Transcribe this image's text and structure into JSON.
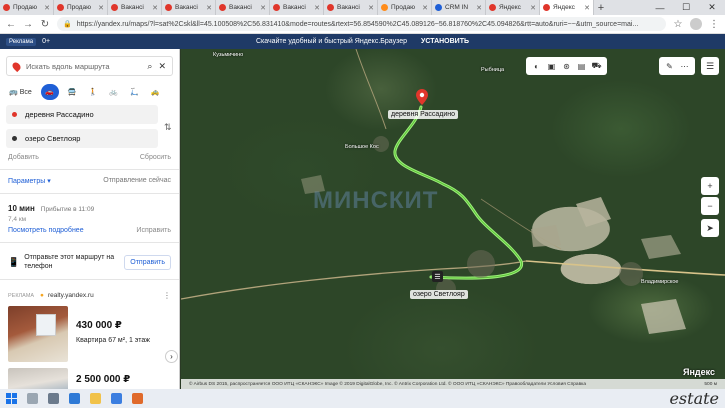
{
  "browser": {
    "tabs": [
      {
        "title": "Продаю",
        "color": "#e0362b"
      },
      {
        "title": "Продаю",
        "color": "#e0362b"
      },
      {
        "title": "Вакансі",
        "color": "#e0362b"
      },
      {
        "title": "Вакансі",
        "color": "#e0362b"
      },
      {
        "title": "Вакансі",
        "color": "#e0362b"
      },
      {
        "title": "Вакансі",
        "color": "#e0362b"
      },
      {
        "title": "Вакансі",
        "color": "#e0362b"
      },
      {
        "title": "Продаю",
        "color": "#ff8c1a"
      },
      {
        "title": "CRM IN",
        "color": "#1f5fd6"
      },
      {
        "title": "Яндекс",
        "color": "#e0362b"
      },
      {
        "title": "Яндекс",
        "color": "#e0362b"
      }
    ],
    "url": "https://yandex.ru/maps/?l=sat%2Cskl&ll=45.100508%2C56.831410&mode=routes&rtext=56.854590%2C45.089126~56.818760%2C45.094826&rtt=auto&ruri=~~&utm_source=mai..."
  },
  "promo": {
    "badge": "Реклама",
    "count": "0+",
    "text": "Скачайте удобный и быстрый Яндекс.Браузер",
    "install": "УСТАНОВИТЬ"
  },
  "panel": {
    "search_placeholder": "Искать вдоль маршрута",
    "modes_all": "Все",
    "from": "деревня Рассадино",
    "to": "озеро Светлояр",
    "add": "Добавить",
    "reset": "Сбросить",
    "params": "Параметры ▾",
    "depart": "Отправление сейчас",
    "route_time": "10 мин",
    "arrival": "Прибытие в 11:09",
    "distance": "7,4 км",
    "details": "Посмотреть подробнее",
    "fix": "Исправить",
    "send_text": "Отправьте этот маршрут на телефон",
    "send_btn": "Отправить",
    "ad_label": "РЕКЛАМА",
    "ad_site": "realty.yandex.ru",
    "listing1_price": "430 000 ₽",
    "listing1_desc": "Квартира 67 м², 1 этаж",
    "listing2_price": "2 500 000 ₽"
  },
  "map": {
    "label_from": "деревня Рассадино",
    "label_to": "озеро Светлояр",
    "small_labels": [
      "Кузьмичино",
      "Большое Кос",
      "Рыбница",
      "Владимирское"
    ],
    "watermark": "МИНСКИТ",
    "copyright": "© Airbus DS 2015, распространяется ООО ИТЦ «СКАНЭКС»   Image © 2019 DigitalGlobe, Inc.   © Antrix Corporation Ltd.   © ООО ИТЦ «СКАНЭКС»   Правообладатели   Условия   Справка",
    "scale": "500 м",
    "logo": "Яндекс"
  },
  "watermark_site": "estate"
}
